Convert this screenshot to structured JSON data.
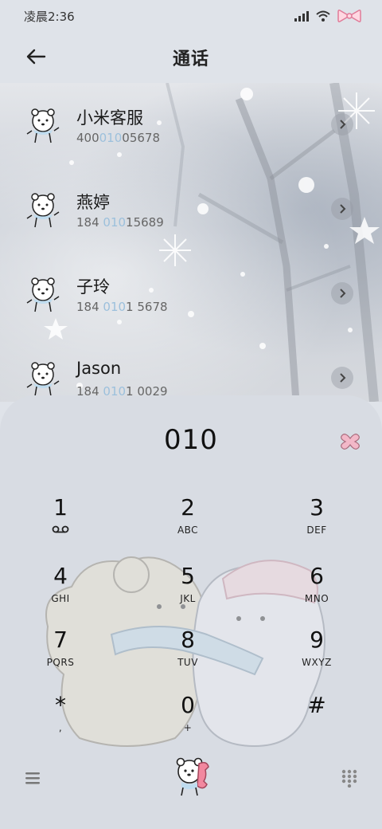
{
  "status_bar": {
    "time": "凌晨2:36"
  },
  "header": {
    "title": "通话"
  },
  "contacts": [
    {
      "name": "小米客服",
      "number_pre": "400",
      "number_hl": "010",
      "number_post": "05678"
    },
    {
      "name": "燕婷",
      "number_pre": "184 ",
      "number_hl": "010",
      "number_post": "15689"
    },
    {
      "name": "子玲",
      "number_pre": "184 ",
      "number_hl": "010",
      "number_post": "1 5678"
    },
    {
      "name": "Jason",
      "number_pre": "184 ",
      "number_hl": "010",
      "number_post": "1 0029"
    }
  ],
  "dialer": {
    "number": "010",
    "keys": [
      {
        "digit": "1",
        "letters": ""
      },
      {
        "digit": "2",
        "letters": "ABC"
      },
      {
        "digit": "3",
        "letters": "DEF"
      },
      {
        "digit": "4",
        "letters": "GHI"
      },
      {
        "digit": "5",
        "letters": "JKL"
      },
      {
        "digit": "6",
        "letters": "MNO"
      },
      {
        "digit": "7",
        "letters": "PQRS"
      },
      {
        "digit": "8",
        "letters": "TUV"
      },
      {
        "digit": "9",
        "letters": "WXYZ"
      },
      {
        "digit": "*",
        "letters": ","
      },
      {
        "digit": "0",
        "letters": "+"
      },
      {
        "digit": "#",
        "letters": ""
      }
    ]
  },
  "icons": {
    "back": "back-arrow-icon",
    "delete": "delete-icon",
    "voicemail": "voicemail-icon",
    "menu": "menu-icon",
    "call": "call-icon",
    "keypad": "keypad-icon"
  },
  "colors": {
    "highlight": "#9cc0dc",
    "delete_pink": "#f2b8c8"
  }
}
